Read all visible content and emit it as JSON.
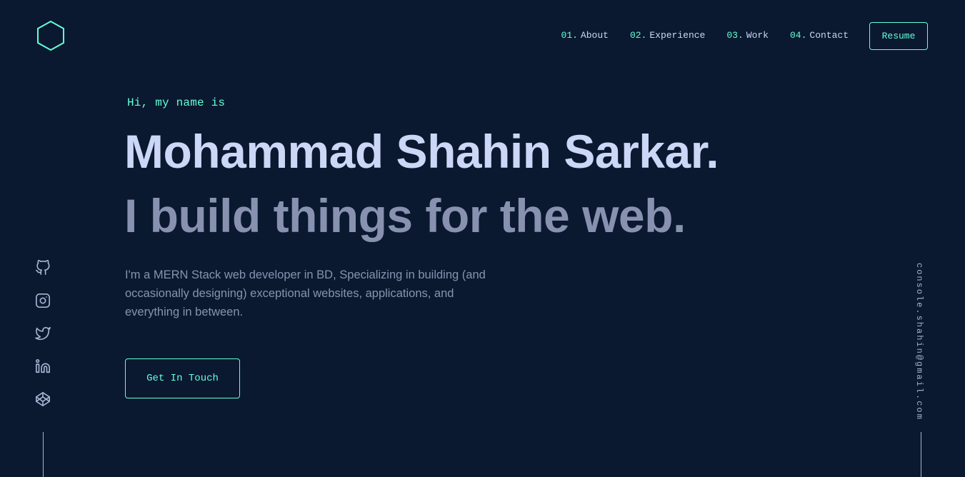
{
  "header": {
    "logo_icon": "hexagon-logo-icon",
    "nav": [
      {
        "number": "01.",
        "label": "About"
      },
      {
        "number": "02.",
        "label": "Experience"
      },
      {
        "number": "03.",
        "label": "Work"
      },
      {
        "number": "04.",
        "label": "Contact"
      }
    ],
    "resume_label": "Resume"
  },
  "hero": {
    "greeting": "Hi, my name is",
    "name": "Mohammad Shahin Sarkar.",
    "tagline": "I build things for the web.",
    "intro": "I'm a MERN Stack web developer in BD, Specializing in building (and occasionally designing) exceptional websites, applications, and everything in between.",
    "cta_label": "Get In Touch"
  },
  "social": [
    {
      "icon": "github-icon"
    },
    {
      "icon": "instagram-icon"
    },
    {
      "icon": "twitter-icon"
    },
    {
      "icon": "linkedin-icon"
    },
    {
      "icon": "codepen-icon"
    }
  ],
  "email": "console.shahin@gmail.com",
  "colors": {
    "background": "#0a192f",
    "accent": "#64ffda",
    "heading": "#ccd6f6",
    "body_text": "#8892b0",
    "light_slate": "#a8b2d1"
  }
}
